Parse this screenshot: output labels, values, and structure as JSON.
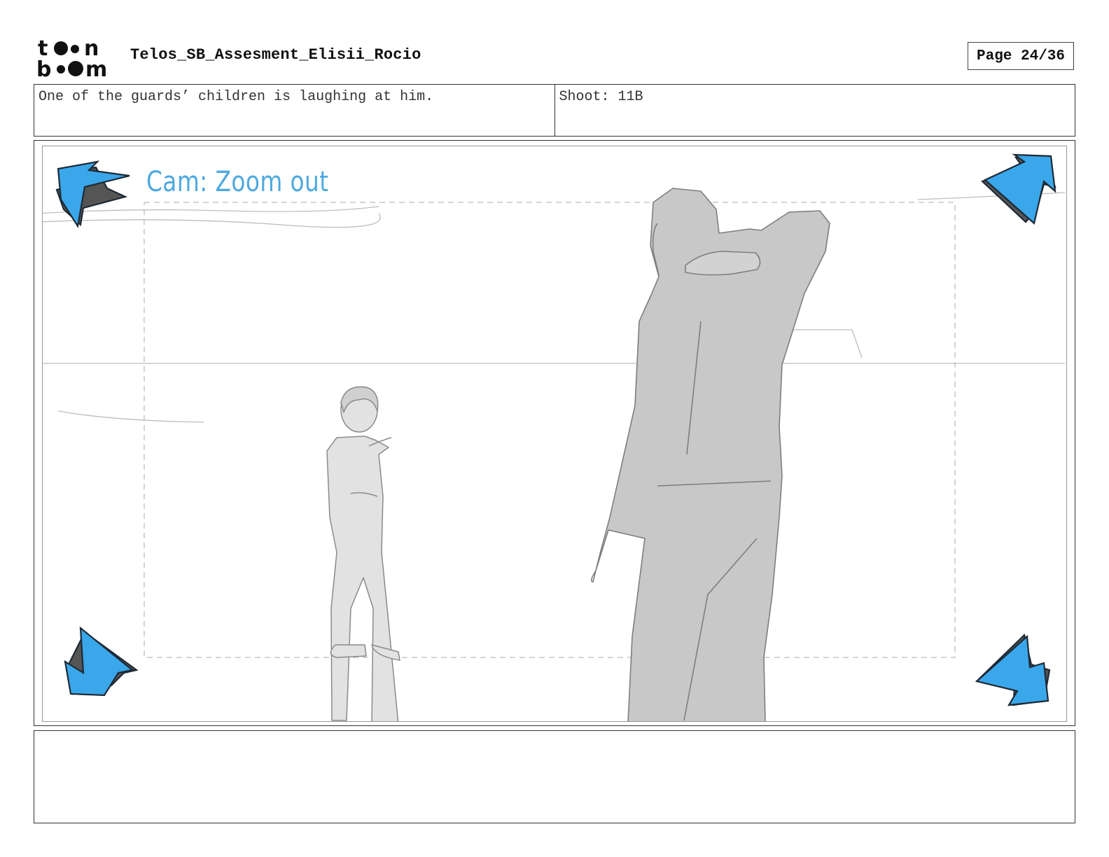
{
  "header": {
    "logo_text": "toon boom",
    "title": "Telos_SB_Assesment_Elisii_Rocio",
    "page_label": "Page 24/36"
  },
  "panel": {
    "action_text": "One of the guards’ children is laughing at him.",
    "shot_text": "Shoot: 11B",
    "camera_note": "Cam: Zoom out",
    "camera_move_arrows": [
      "top-left",
      "top-right",
      "bottom-left",
      "bottom-right"
    ],
    "dialogue_notes": ""
  },
  "colors": {
    "arrow_fill": "#3aa7ea",
    "camera_note": "#4ea9df",
    "figure_fill": "#c8c8c8",
    "child_fill": "#e2e2e2"
  }
}
